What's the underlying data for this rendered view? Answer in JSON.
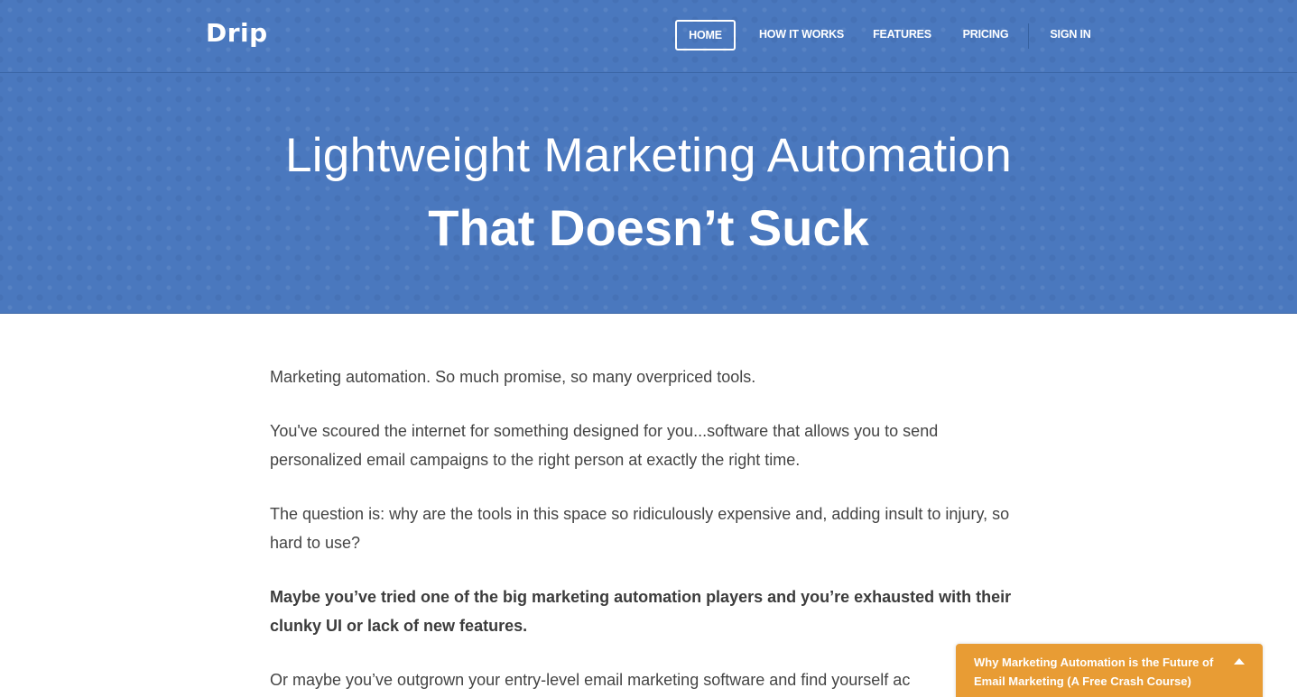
{
  "brand": {
    "logo": "Drip"
  },
  "nav": {
    "home": "HOME",
    "how_it_works": "HOW IT WORKS",
    "features": "FEATURES",
    "pricing": "PRICING",
    "sign_in": "SIGN IN"
  },
  "hero": {
    "line1": "Lightweight Marketing Automation",
    "line2": "That Doesn’t Suck"
  },
  "content": {
    "p1": "Marketing automation. So much promise, so many overpriced tools.",
    "p2": "You've scoured the internet for something designed for you...software that allows you to send personalized email campaigns to the right person at exactly the right time.",
    "p3": "The question is: why are the tools in this space so ridiculously expensive and, adding insult to injury, so hard to use?",
    "p4": "Maybe you’ve tried one of the big marketing automation players and you’re exhausted with their clunky UI or lack of new features.",
    "p5": "Or maybe you’ve outgrown your entry-level email marketing software and find yourself ac"
  },
  "popup": {
    "title": "Why Marketing Automation is the Future of Email Marketing (A Free Crash Course)",
    "icon": "caret-up-icon"
  },
  "colors": {
    "hero_bg": "#4a78be",
    "popup_bg": "#e89c34",
    "text": "#444444"
  }
}
